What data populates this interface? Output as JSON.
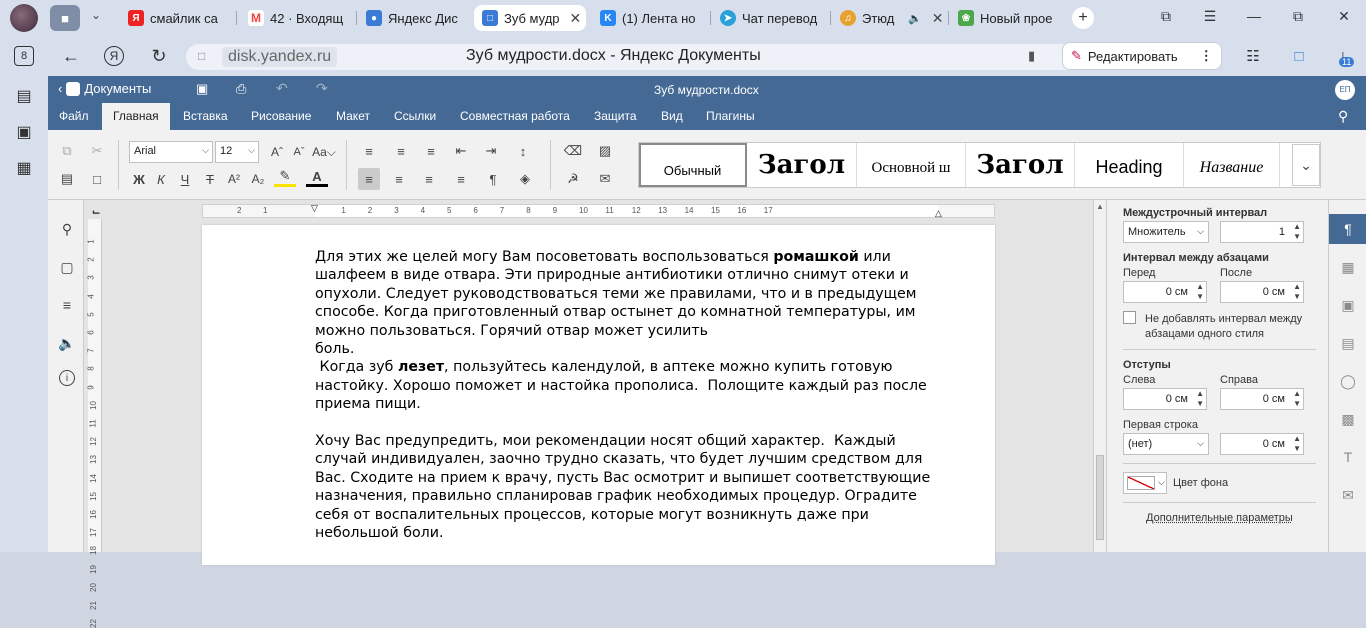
{
  "tabs": [
    {
      "label": "смайлик са",
      "color": "#e22"
    },
    {
      "label": "42 · Входящ",
      "color": "#e44"
    },
    {
      "label": "Яндекс Дис",
      "color": "#3a7bd5"
    },
    {
      "label": "Зуб мудр",
      "color": "#3a7bd5"
    },
    {
      "label": "(1) Лента но",
      "color": "#2787f5"
    },
    {
      "label": "Чат перевод",
      "color": "#2aa0d8"
    },
    {
      "label": "Этюд",
      "color": "#e8a030"
    },
    {
      "label": "Новый прое",
      "color": "#4aa84a"
    }
  ],
  "browser": {
    "domain": "disk.yandex.ru",
    "title": "Зуб мудрости.docx - Яндекс Документы",
    "edit_label": "Редактировать",
    "downloads_badge": "11",
    "rail_badge": "8"
  },
  "doc": {
    "back_label": "Документы",
    "filename": "Зуб мудрости.docx",
    "user_initials": "ЕП"
  },
  "menu": [
    "Файл",
    "Главная",
    "Вставка",
    "Рисование",
    "Макет",
    "Ссылки",
    "Совместная работа",
    "Защита",
    "Вид",
    "Плагины"
  ],
  "toolbar": {
    "font": "Arial",
    "size": "12",
    "bold": "Ж",
    "italic": "К",
    "underline": "Ч",
    "strike": "Т",
    "styles": [
      "Обычный",
      "Загол",
      "Основной ш",
      "Загол",
      "Heading",
      "Название"
    ]
  },
  "ruler": {
    "h": [
      "2",
      "1",
      "1",
      "2",
      "3",
      "4",
      "5",
      "6",
      "7",
      "8",
      "9",
      "10",
      "11",
      "12",
      "13",
      "14",
      "15",
      "16",
      "17"
    ],
    "v": [
      "1",
      "2",
      "3",
      "4",
      "5",
      "6",
      "7",
      "8",
      "9",
      "10",
      "11",
      "12",
      "13",
      "14",
      "15",
      "16",
      "17",
      "18",
      "19",
      "20",
      "21",
      "22"
    ]
  },
  "text": {
    "p1a": "Для этих же целей могу Вам посоветовать воспользоваться ",
    "p1b": "ромашкой",
    "p1c": " или",
    "p1l2": "шалфеем в виде отвара. Эти природные антибиотики отлично снимут отеки и",
    "p1l3": "опухоли. Следует руководствоваться теми же правилами, что и в предыдущем",
    "p1l4": "способе. Когда приготовленный отвар остынет до комнатной температуры, им",
    "p1l5": "можно пользоваться. Горячий отвар может усилить",
    "p1l6": "боль.",
    "p2a": " Когда зуб ",
    "p2b": "лезет",
    "p2c": ", пользуйтесь календулой, в аптеке можно купить готовую",
    "p2l2": "настойку. Хорошо поможет и настойка прополиса.  Полощите каждый раз после",
    "p2l3": "приема пищи.",
    "p3l1": "Хочу Вас предупредить, мои рекомендации носят общий характер.  Каждый",
    "p3l2": "случай индивидуален, заочно трудно сказать, что будет лучшим средством для",
    "p3l3": "Вас. Сходите на прием к врачу, пусть Вас осмотрит и выпишет соответствующие",
    "p3l4": "назначения, правильно спланировав график необходимых процедур. Оградите",
    "p3l5": "себя от воспалительных процессов, которые могут возникнуть даже при",
    "p3l6": "небольшой боли."
  },
  "para": {
    "line_spacing_title": "Междустрочный интервал",
    "line_mode": "Множитель",
    "line_value": "1",
    "para_spacing_title": "Интервал между абзацами",
    "before_label": "Перед",
    "after_label": "После",
    "before_value": "0 см",
    "after_value": "0 см",
    "no_space_label_1": "Не добавлять интервал между",
    "no_space_label_2": "абзацами одного стиля",
    "indents_title": "Отступы",
    "left_label": "Слева",
    "right_label": "Справа",
    "left_value": "0 см",
    "right_value": "0 см",
    "first_line_label": "Первая строка",
    "first_line_mode": "(нет)",
    "first_line_value": "0 см",
    "bg_color_label": "Цвет фона",
    "more_label": "Дополнительные параметры"
  }
}
